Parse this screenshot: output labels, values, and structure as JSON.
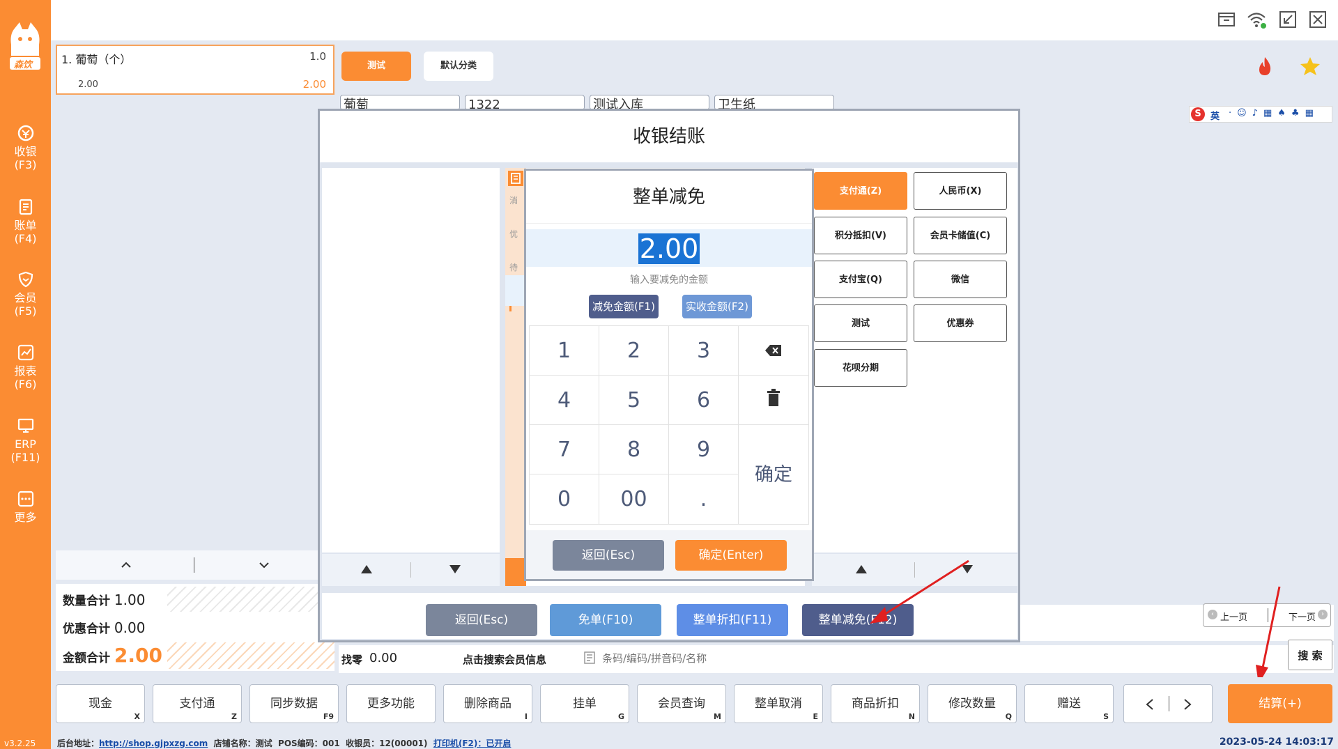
{
  "brand": {
    "logo_text": "森饮",
    "version": "v3.2.25",
    "accent": "#fb8c33"
  },
  "sidebar": {
    "items": [
      {
        "label": "收银",
        "key": "(F3)"
      },
      {
        "label": "账单",
        "key": "(F4)"
      },
      {
        "label": "会员",
        "key": "(F5)"
      },
      {
        "label": "报表",
        "key": "(F6)"
      },
      {
        "label": "ERP",
        "key": "(F11)"
      },
      {
        "label": "更多",
        "key": ""
      }
    ]
  },
  "cart": {
    "item": {
      "index": "1.",
      "name": "葡萄（个）",
      "qty": "1.0",
      "price": "2.00",
      "subtotal": "2.00"
    },
    "totals": {
      "qty_label": "数量合计",
      "qty_value": "1.00",
      "discount_label": "优惠合计",
      "discount_value": "0.00",
      "amount_label": "金额合计",
      "amount_value": "2.00"
    }
  },
  "categories": {
    "active": "测试",
    "default": "默认分类"
  },
  "product_tabs": [
    "葡萄",
    "1322",
    "测试入库",
    "卫生纸"
  ],
  "checkout": {
    "title": "收银结账",
    "payments": [
      "支付通(Z)",
      "人民币(X)",
      "积分抵扣(V)",
      "会员卡储值(C)",
      "支付宝(Q)",
      "微信",
      "测试",
      "优惠券",
      "花呗分期"
    ],
    "mid_chars": [
      "消",
      "优",
      "待"
    ],
    "footer": {
      "back": "返回(Esc)",
      "free": "免单(F10)",
      "discount": "整单折扣(F11)",
      "reduce": "整单减免(F12)"
    }
  },
  "reduce_dialog": {
    "title": "整单减免",
    "value": "2.00",
    "hint": "输入要减免的金额",
    "mode_reduce": "减免金额(F1)",
    "mode_actual": "实收金额(F2)",
    "keys": {
      "k1": "1",
      "k2": "2",
      "k3": "3",
      "k4": "4",
      "k5": "5",
      "k6": "6",
      "k7": "7",
      "k8": "8",
      "k9": "9",
      "k0": "0",
      "k00": "00",
      "dot": ".",
      "confirm": "确定"
    },
    "back": "返回(Esc)",
    "ok": "确定(Enter)"
  },
  "search": {
    "change_label": "找零",
    "change_value": "0.00",
    "member_link": "点击搜索会员信息",
    "placeholder": "条码/编码/拼音码/名称",
    "search_btn": "搜 索",
    "prev": "上一页",
    "next": "下一页"
  },
  "ime": {
    "lang": "英"
  },
  "functions": [
    {
      "label": "现金",
      "key": "X"
    },
    {
      "label": "支付通",
      "key": "Z"
    },
    {
      "label": "同步数据",
      "key": "F9"
    },
    {
      "label": "更多功能",
      "key": ""
    },
    {
      "label": "删除商品",
      "key": "I"
    },
    {
      "label": "挂单",
      "key": "G"
    },
    {
      "label": "会员查询",
      "key": "M"
    },
    {
      "label": "整单取消",
      "key": "E"
    },
    {
      "label": "商品折扣",
      "key": "N"
    },
    {
      "label": "修改数量",
      "key": "Q"
    },
    {
      "label": "赠送",
      "key": "S"
    }
  ],
  "settle": "结算(+)",
  "status": {
    "backend_label": "后台地址：",
    "backend_url": "http://shop.gjpxzg.com",
    "store": "店铺名称：测试",
    "pos": "POS编码：001",
    "cashier": "收银员：12(00001)",
    "printer": "打印机(F2)：已开启",
    "datetime": "2023-05-24 14:03:17"
  }
}
